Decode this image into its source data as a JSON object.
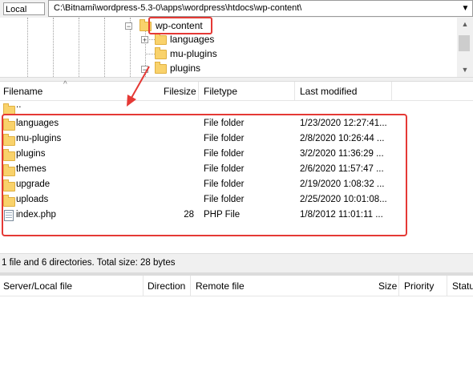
{
  "local_site": {
    "label": "Local site:",
    "path": "C:\\Bitnami\\wordpress-5.3-0\\apps\\wordpress\\htdocs\\wp-content\\",
    "dropdown_icon": "chevron-down-icon"
  },
  "tree": {
    "selected": "wp-content",
    "children": [
      "languages",
      "mu-plugins",
      "plugins"
    ]
  },
  "file_list": {
    "columns": [
      "Filename",
      "Filesize",
      "Filetype",
      "Last modified"
    ],
    "parent_entry": "..",
    "rows": [
      {
        "name": "languages",
        "size": "",
        "type": "File folder",
        "modified": "1/23/2020 12:27:41...",
        "icon": "folder-icon"
      },
      {
        "name": "mu-plugins",
        "size": "",
        "type": "File folder",
        "modified": "2/8/2020 10:26:44 ...",
        "icon": "folder-icon"
      },
      {
        "name": "plugins",
        "size": "",
        "type": "File folder",
        "modified": "3/2/2020 11:36:29 ...",
        "icon": "folder-icon"
      },
      {
        "name": "themes",
        "size": "",
        "type": "File folder",
        "modified": "2/6/2020 11:57:47 ...",
        "icon": "folder-icon"
      },
      {
        "name": "upgrade",
        "size": "",
        "type": "File folder",
        "modified": "2/19/2020 1:08:32 ...",
        "icon": "folder-icon"
      },
      {
        "name": "uploads",
        "size": "",
        "type": "File folder",
        "modified": "2/25/2020 10:01:08...",
        "icon": "folder-icon"
      },
      {
        "name": "index.php",
        "size": "28",
        "type": "PHP File",
        "modified": "1/8/2012 11:01:11 ...",
        "icon": "php-file-icon"
      }
    ]
  },
  "status": {
    "text": "1 file and 6 directories. Total size: 28 bytes"
  },
  "queue": {
    "columns": [
      "Server/Local file",
      "Direction",
      "Remote file",
      "Size",
      "Priority",
      "Status"
    ]
  },
  "colors": {
    "highlight": "#e53935",
    "folder": "#f9d26b"
  }
}
